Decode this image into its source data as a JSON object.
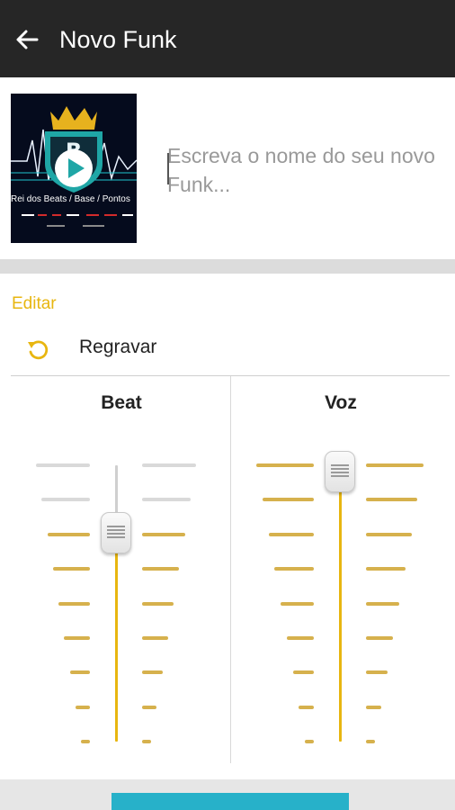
{
  "appbar": {
    "title": "Novo Funk",
    "back_icon": "arrow-left-icon"
  },
  "cover": {
    "caption": "Rei dos Beats / Base / Pontos"
  },
  "name_input": {
    "placeholder": "Escreva o nome do seu novo Funk...",
    "value": ""
  },
  "edit": {
    "section_label": "Editar",
    "rerecord_label": "Regravar",
    "rerecord_icon": "undo-icon",
    "beat": {
      "title": "Beat",
      "level": 0.78
    },
    "voice": {
      "title": "Voz",
      "level": 1.0
    }
  },
  "colors": {
    "accent": "#e8b610",
    "tick_on": "#d6b14d",
    "tick_off": "#d9d9d9",
    "button": "#27b1c9"
  }
}
